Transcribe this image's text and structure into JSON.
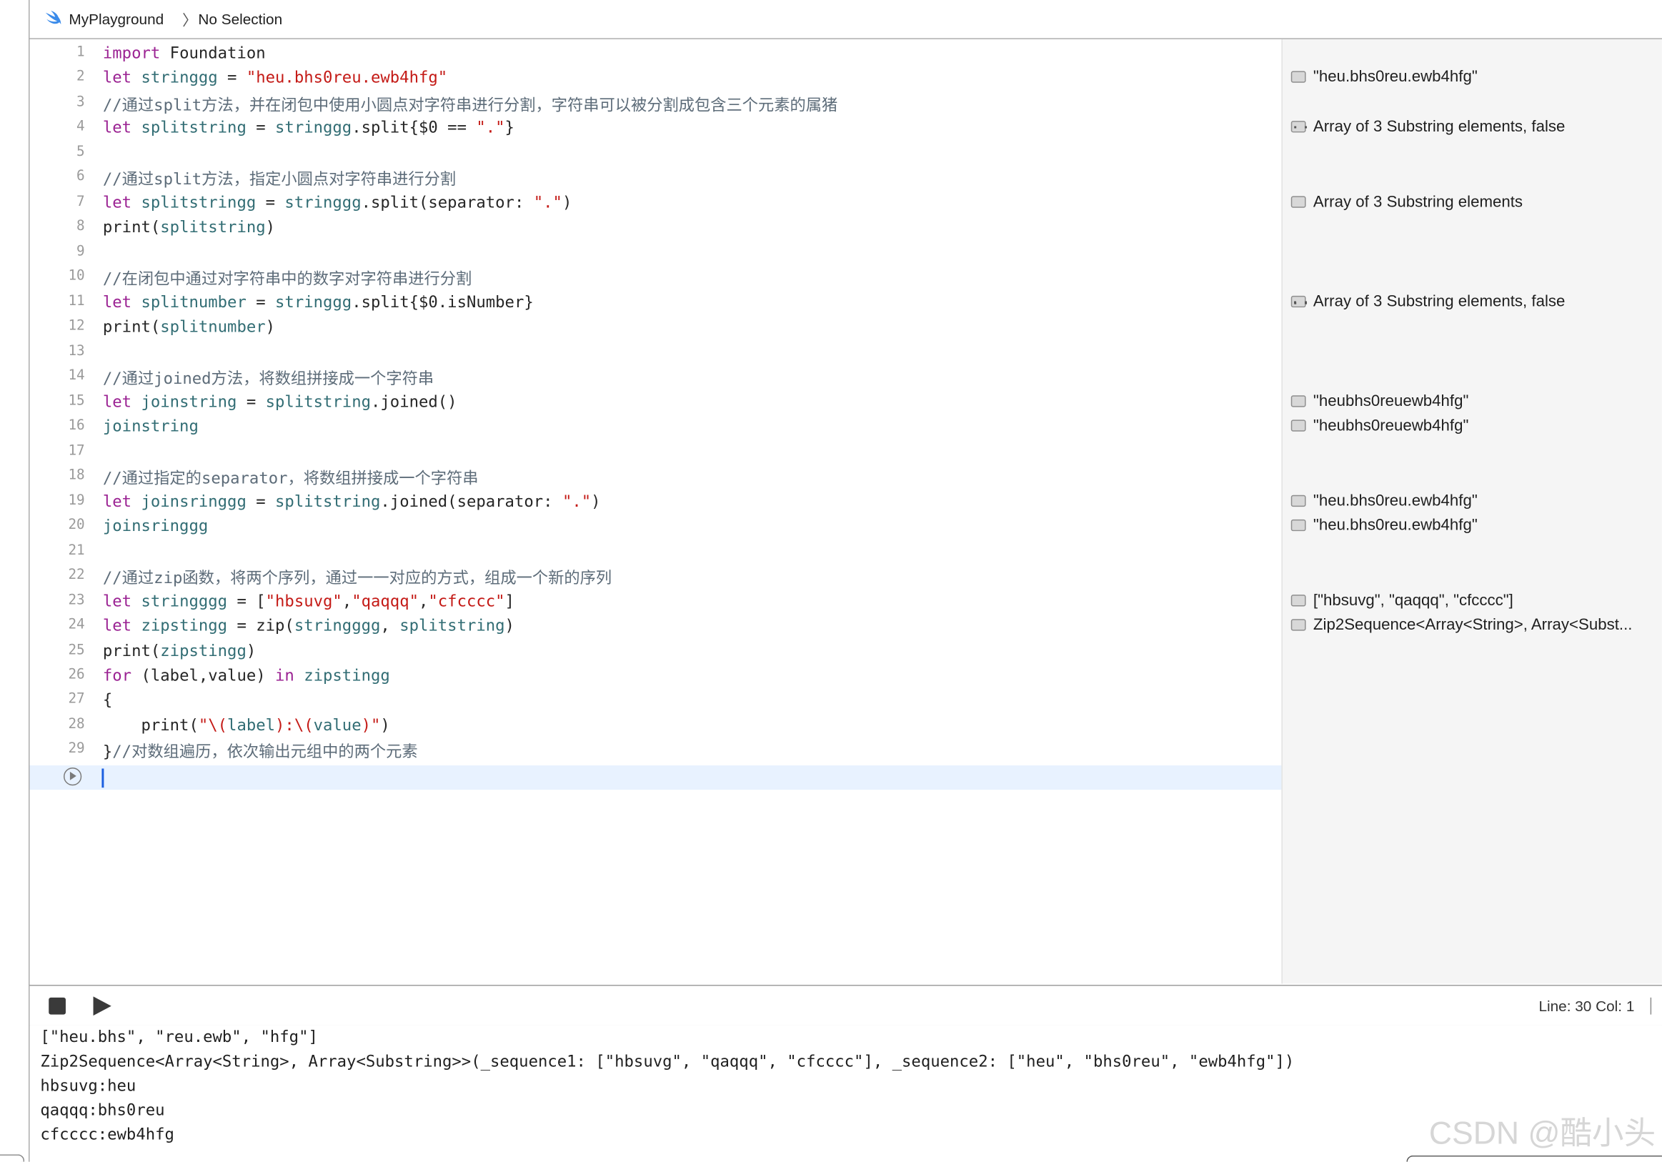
{
  "breadcrumb": {
    "project": "MyPlayground",
    "selection": "No Selection"
  },
  "editor": {
    "lines": [
      {
        "n": "1",
        "segs": [
          [
            "kw",
            "import"
          ],
          [
            "",
            "Foundation"
          ]
        ]
      },
      {
        "n": "2",
        "segs": [
          [
            "kw",
            "let"
          ],
          [
            "idn",
            "stringgg"
          ],
          [
            "",
            " = "
          ],
          [
            "str",
            "\"heu.bhs0reu.ewb4hfg\""
          ]
        ]
      },
      {
        "n": "3",
        "segs": [
          [
            "cm",
            "//通过split方法，并在闭包中使用小圆点对字符串进行分割，字符串可以被分割成包含三个元素的属猪"
          ]
        ]
      },
      {
        "n": "4",
        "segs": [
          [
            "kw",
            "let"
          ],
          [
            "idn",
            "splitstring"
          ],
          [
            "",
            " = "
          ],
          [
            "idn",
            "stringgg"
          ],
          [
            "",
            ".split{$0 == "
          ],
          [
            "str",
            "\".\""
          ],
          [
            "",
            "}"
          ]
        ]
      },
      {
        "n": "5",
        "segs": []
      },
      {
        "n": "6",
        "segs": [
          [
            "cm",
            "//通过split方法，指定小圆点对字符串进行分割"
          ]
        ]
      },
      {
        "n": "7",
        "segs": [
          [
            "kw",
            "let"
          ],
          [
            "idn",
            "splitstringg"
          ],
          [
            "",
            " = "
          ],
          [
            "idn",
            "stringgg"
          ],
          [
            "",
            ".split(separator: "
          ],
          [
            "str",
            "\".\""
          ],
          [
            "",
            ")"
          ]
        ]
      },
      {
        "n": "8",
        "segs": [
          [
            "",
            "print("
          ],
          [
            "idn",
            "splitstring"
          ],
          [
            "",
            ")"
          ]
        ]
      },
      {
        "n": "9",
        "segs": []
      },
      {
        "n": "10",
        "segs": [
          [
            "cm",
            "//在闭包中通过对字符串中的数字对字符串进行分割"
          ]
        ]
      },
      {
        "n": "11",
        "segs": [
          [
            "kw",
            "let"
          ],
          [
            "idn",
            "splitnumber"
          ],
          [
            "",
            " = "
          ],
          [
            "idn",
            "stringgg"
          ],
          [
            "",
            ".split{$0.isNumber}"
          ]
        ]
      },
      {
        "n": "12",
        "segs": [
          [
            "",
            "print("
          ],
          [
            "idn",
            "splitnumber"
          ],
          [
            "",
            ")"
          ]
        ]
      },
      {
        "n": "13",
        "segs": []
      },
      {
        "n": "14",
        "segs": [
          [
            "cm",
            "//通过joined方法，将数组拼接成一个字符串"
          ]
        ]
      },
      {
        "n": "15",
        "segs": [
          [
            "kw",
            "let"
          ],
          [
            "idn",
            "joinstring"
          ],
          [
            "",
            " = "
          ],
          [
            "idn",
            "splitstring"
          ],
          [
            "",
            ".joined()"
          ]
        ]
      },
      {
        "n": "16",
        "segs": [
          [
            "idn",
            "joinstring"
          ]
        ]
      },
      {
        "n": "17",
        "segs": []
      },
      {
        "n": "18",
        "segs": [
          [
            "cm",
            "//通过指定的separator，将数组拼接成一个字符串"
          ]
        ]
      },
      {
        "n": "19",
        "segs": [
          [
            "kw",
            "let"
          ],
          [
            "idn",
            "joinsringgg"
          ],
          [
            "",
            " = "
          ],
          [
            "idn",
            "splitstring"
          ],
          [
            "",
            ".joined(separator: "
          ],
          [
            "str",
            "\".\""
          ],
          [
            "",
            ")"
          ]
        ]
      },
      {
        "n": "20",
        "segs": [
          [
            "idn",
            "joinsringgg"
          ]
        ]
      },
      {
        "n": "21",
        "segs": []
      },
      {
        "n": "22",
        "segs": [
          [
            "cm",
            "//通过zip函数，将两个序列，通过一一对应的方式，组成一个新的序列"
          ]
        ]
      },
      {
        "n": "23",
        "segs": [
          [
            "kw",
            "let"
          ],
          [
            "idn",
            "stringggg"
          ],
          [
            "",
            " = ["
          ],
          [
            "str",
            "\"hbsuvg\""
          ],
          [
            "",
            ","
          ],
          [
            "str",
            "\"qaqqq\""
          ],
          [
            "",
            ","
          ],
          [
            "str",
            "\"cfcccc\""
          ],
          [
            "",
            "]"
          ]
        ]
      },
      {
        "n": "24",
        "segs": [
          [
            "kw",
            "let"
          ],
          [
            "idn",
            "zipstingg"
          ],
          [
            "",
            " = zip("
          ],
          [
            "idn",
            "stringggg"
          ],
          [
            "",
            ", "
          ],
          [
            "idn",
            "splitstring"
          ],
          [
            "",
            ")"
          ]
        ]
      },
      {
        "n": "25",
        "segs": [
          [
            "",
            "print("
          ],
          [
            "idn",
            "zipstingg"
          ],
          [
            "",
            ")"
          ]
        ]
      },
      {
        "n": "26",
        "segs": [
          [
            "kw",
            "for"
          ],
          [
            "",
            "(label,value) "
          ],
          [
            "kw",
            "in"
          ],
          [
            "idn",
            "zipstingg"
          ]
        ]
      },
      {
        "n": "27",
        "segs": [
          [
            "",
            "{"
          ]
        ]
      },
      {
        "n": "28",
        "segs": [
          [
            "",
            "    print("
          ],
          [
            "str",
            "\"\\("
          ],
          [
            "idn",
            "label"
          ],
          [
            "str",
            "):\\("
          ],
          [
            "idn",
            "value"
          ],
          [
            "str",
            ")\""
          ],
          [
            "",
            ")"
          ]
        ]
      },
      {
        "n": "29",
        "segs": [
          [
            "",
            "}"
          ],
          [
            "cm",
            "//对数组遍历，依次输出元组中的两个元素"
          ]
        ]
      }
    ]
  },
  "results": [
    {
      "line": 2,
      "icon": "value-icon",
      "text": "\"heu.bhs0reu.ewb4hfg\""
    },
    {
      "line": 4,
      "icon": "array-icon",
      "text": "Array of 3 Substring elements, false"
    },
    {
      "line": 7,
      "icon": "value-icon",
      "text": "Array of 3 Substring elements"
    },
    {
      "line": 11,
      "icon": "array-icon",
      "text": "Array of 3 Substring elements, false"
    },
    {
      "line": 15,
      "icon": "value-icon",
      "text": "\"heubhs0reuewb4hfg\""
    },
    {
      "line": 16,
      "icon": "value-icon",
      "text": "\"heubhs0reuewb4hfg\""
    },
    {
      "line": 19,
      "icon": "value-icon",
      "text": "\"heu.bhs0reu.ewb4hfg\""
    },
    {
      "line": 20,
      "icon": "value-icon",
      "text": "\"heu.bhs0reu.ewb4hfg\""
    },
    {
      "line": 23,
      "icon": "value-icon",
      "text": "[\"hbsuvg\", \"qaqqq\", \"cfcccc\"]"
    },
    {
      "line": 24,
      "icon": "value-icon",
      "text": "Zip2Sequence<Array<String>, Array<Subst..."
    }
  ],
  "status": {
    "line_col": "Line: 30  Col: 1"
  },
  "console": {
    "lines": [
      "[\"heu.bhs\", \"reu.ewb\", \"hfg\"]",
      "Zip2Sequence<Array<String>, Array<Substring>>(_sequence1: [\"hbsuvg\", \"qaqqq\", \"cfcccc\"], _sequence2: [\"heu\", \"bhs0reu\", \"ewb4hfg\"])",
      "hbsuvg:heu",
      "qaqqq:bhs0reu",
      "cfcccc:ewb4hfg"
    ]
  },
  "watermark": "CSDN @酷小头"
}
